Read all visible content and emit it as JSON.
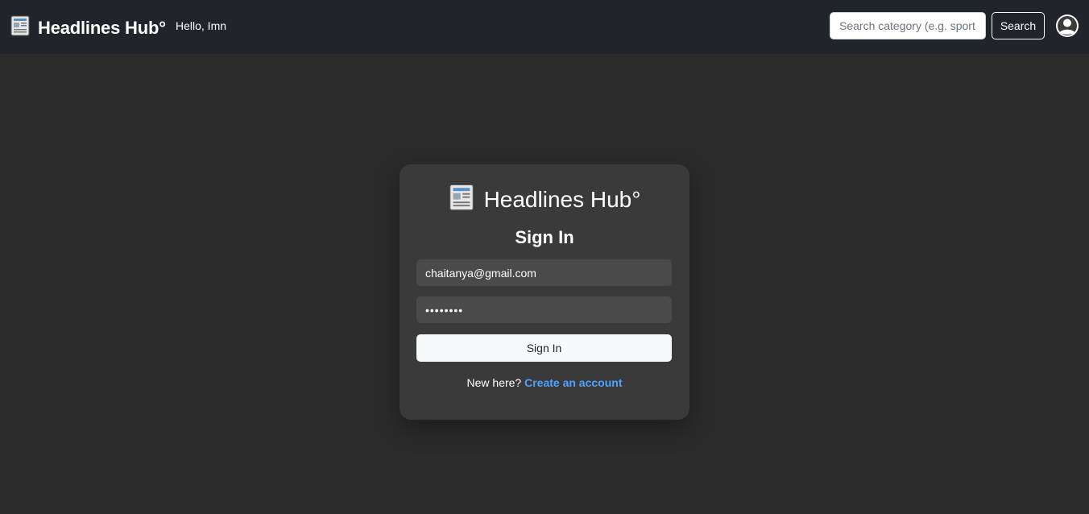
{
  "header": {
    "brand": "Headlines Hub°",
    "greeting": "Hello, Imn",
    "search_placeholder": "Search category (e.g. sport",
    "search_label": "Search",
    "icons": {
      "logo": "newspaper-icon",
      "user": "user-avatar-icon"
    }
  },
  "signin": {
    "brand": "Headlines Hub°",
    "title": "Sign In",
    "email_value": "chaitanya@gmail.com",
    "password_value": "••••••••",
    "button_label": "Sign In",
    "signup_prompt": "New here?",
    "signup_link": "Create an account"
  },
  "colors": {
    "page_bg": "#2b2b2b",
    "navbar_bg": "#212529",
    "card_bg": "#3a3a3a",
    "field_bg": "#4a4a4a",
    "link": "#4da3ff"
  }
}
